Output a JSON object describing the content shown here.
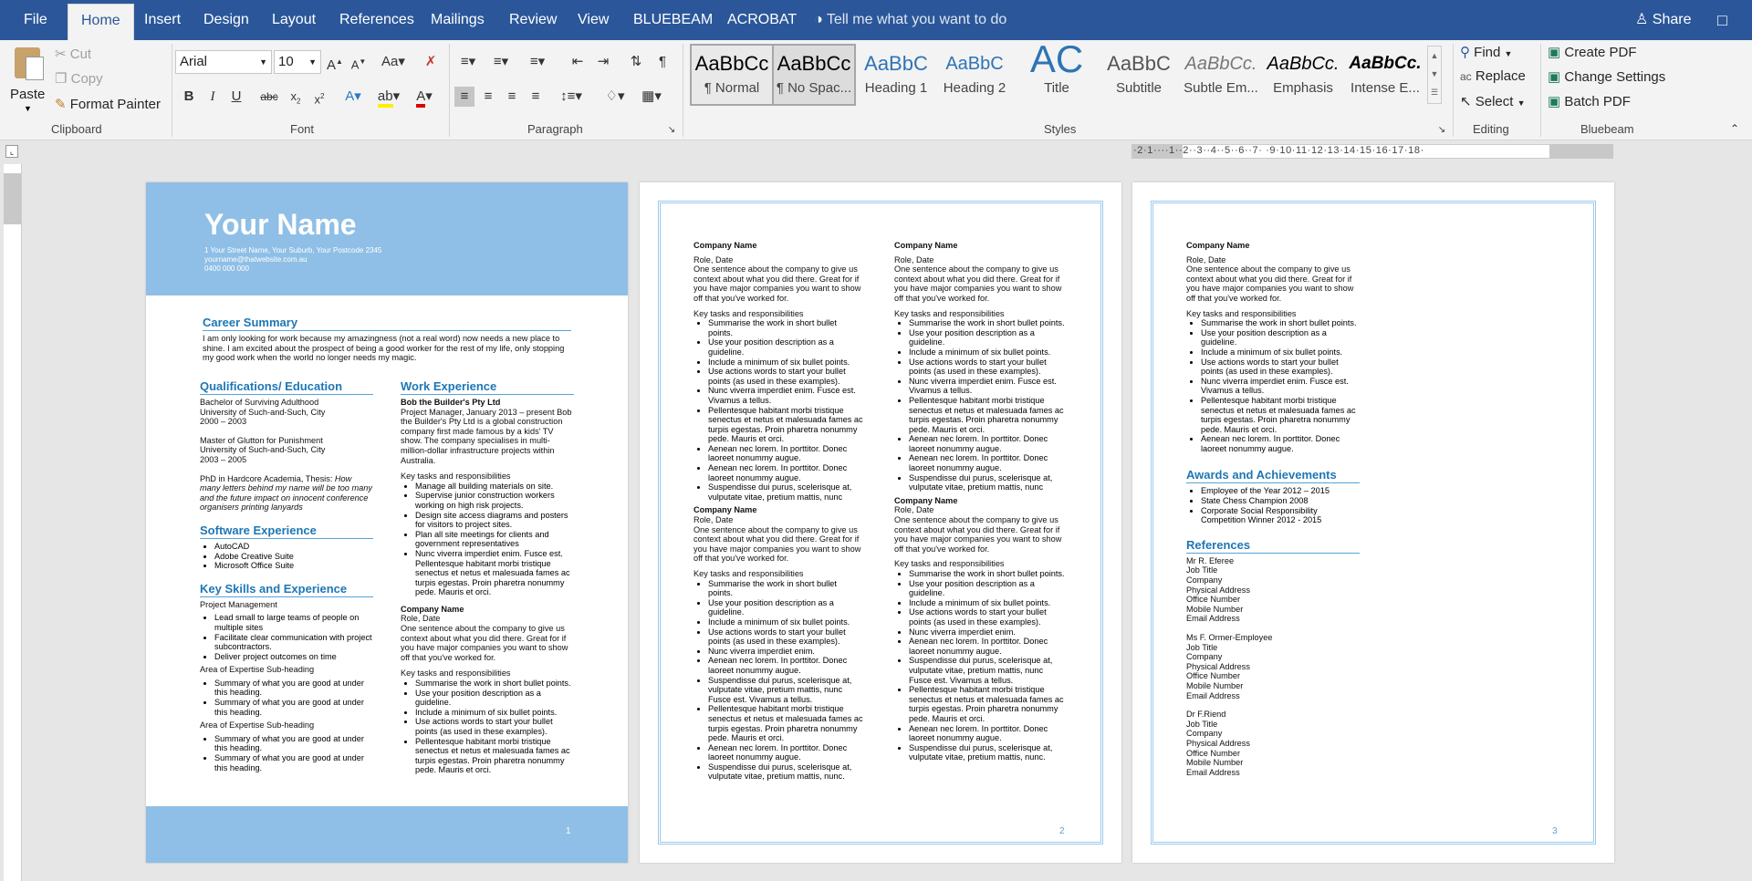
{
  "menubar": {
    "file": "File",
    "tabs": [
      "Home",
      "Insert",
      "Design",
      "Layout",
      "References",
      "Mailings",
      "Review",
      "View",
      "BLUEBEAM",
      "ACROBAT"
    ],
    "tell_me": "Tell me what you want to do",
    "share": "Share"
  },
  "clipboard": {
    "paste": "Paste",
    "cut": "Cut",
    "copy": "Copy",
    "format_painter": "Format Painter",
    "group": "Clipboard"
  },
  "font": {
    "name": "Arial",
    "size": "10",
    "group": "Font"
  },
  "paragraph": {
    "group": "Paragraph"
  },
  "styles": {
    "group": "Styles",
    "items": [
      {
        "preview": "AaBbCc",
        "label": "¶ Normal"
      },
      {
        "preview": "AaBbCc",
        "label": "¶ No Spac..."
      },
      {
        "preview": "AaBbC",
        "label": "Heading 1"
      },
      {
        "preview": "AaBbC",
        "label": "Heading 2"
      },
      {
        "preview": "AC",
        "label": "Title"
      },
      {
        "preview": "AaBbC",
        "label": "Subtitle"
      },
      {
        "preview": "AaBbCc.",
        "label": "Subtle Em..."
      },
      {
        "preview": "AaBbCc.",
        "label": "Emphasis"
      },
      {
        "preview": "AaBbCc.",
        "label": "Intense E..."
      }
    ]
  },
  "editing": {
    "find": "Find",
    "replace": "Replace",
    "select": "Select",
    "group": "Editing"
  },
  "bluebeam": {
    "create_pdf": "Create PDF",
    "change_settings": "Change Settings",
    "batch_pdf": "Batch PDF",
    "group": "Bluebeam"
  },
  "ruler": {
    "text": "·2·1····1··2··3··4··5··6··7·  ·9·10·11·12·13·14·15·16·17·18·"
  },
  "page1": {
    "name": "Your Name",
    "address": "1 Your Street Name, Your Suburb, Your Postcode 2345",
    "email": "yourname@thatwebsite.com.au",
    "phone": "0400 000 000",
    "career_h": "Career Summary",
    "career": "I am only looking for work because my amazingness (not a real word) now needs a new place to shine. I am excited about the prospect of being a good worker for the rest of my life, only stopping my good work when the world no longer needs my magic.",
    "qual_h": "Qualifications/ Education",
    "q1": [
      "Bachelor of Surviving Adulthood",
      "University of Such-and-Such, City",
      "2000 – 2003"
    ],
    "q2": [
      "Master of Glutton for Punishment",
      "University of Such-and-Such, City",
      "2003 – 2005"
    ],
    "q3a": "PhD in Hardcore Academia, Thesis: ",
    "q3b": "How many letters behind my name will be too many and the future impact on innocent conference organisers printing lanyards",
    "soft_h": "Software Experience",
    "soft": [
      "AutoCAD",
      "Adobe Creative Suite",
      "Microsoft Office Suite"
    ],
    "skills_h": "Key Skills and Experience",
    "pm": "Project Management",
    "pm_items": [
      "Lead small to large teams of people on multiple sites",
      "Facilitate clear communication with project subcontractors.",
      "Deliver project outcomes on time"
    ],
    "area": "Area of Expertise Sub-heading",
    "area_items": [
      "Summary of what you are good at under this heading.",
      "Summary of what you are good at under this heading."
    ],
    "work_h": "Work Experience",
    "w1_company": "Bob the Builder's Pty Ltd",
    "w1_text": "Project Manager, January 2013 – present Bob the Builder's Pty Ltd is a global construction company first made famous by a kids' TV show. The company specialises in multi-million-dollar infrastructure projects within Australia.",
    "w1_items": [
      "Manage all building materials on site.",
      "Supervise junior construction workers working on high risk projects.",
      "Design site access diagrams and posters for visitors to project sites.",
      "Plan all site meetings for clients and government representatives",
      "Nunc viverra imperdiet enim. Fusce est. Pellentesque habitant morbi tristique senectus et netus et malesuada fames ac turpis egestas. Proin pharetra nonummy pede. Mauris et orci."
    ],
    "w2_items": [
      "Summarise the work in short bullet points.",
      "Use your position description as a guideline.",
      "Include a minimum of six bullet points.",
      "Use actions words to start your bullet points (as used in these examples).",
      "Pellentesque habitant morbi tristique senectus et netus et malesuada fames ac turpis egestas. Proin pharetra nonummy pede. Mauris et orci."
    ],
    "num": "1"
  },
  "common": {
    "company": "Company Name",
    "role": "Role, Date",
    "sentence": "One sentence about the company to give us context about what you did there. Great for if you have major companies you want to show off that you've worked for.",
    "key": "Key tasks and responsibilities",
    "items_a": [
      "Summarise the work in short bullet points.",
      "Use your position description as a guideline.",
      "Include a minimum of six bullet points.",
      "Use actions words to start your bullet points (as used in these examples).",
      "Nunc viverra imperdiet enim. Fusce est. Vivamus a tellus.",
      "Pellentesque habitant morbi tristique senectus et netus et malesuada fames ac turpis egestas. Proin pharetra nonummy pede. Mauris et orci.",
      "Aenean nec lorem. In porttitor. Donec laoreet nonummy augue.",
      "Aenean nec lorem. In porttitor. Donec laoreet nonummy augue.",
      "Suspendisse dui purus, scelerisque at, vulputate vitae, pretium mattis, nunc"
    ],
    "items_b": [
      "Summarise the work in short bullet points.",
      "Use your position description as a guideline.",
      "Include a minimum of six bullet points.",
      "Use actions words to start your bullet points (as used in these examples).",
      "Nunc viverra imperdiet enim.",
      "Aenean nec lorem. In porttitor. Donec laoreet nonummy augue.",
      "Suspendisse dui purus, scelerisque at, vulputate vitae, pretium mattis, nunc Fusce est. Vivamus a tellus.",
      "Pellentesque habitant morbi tristique senectus et netus et malesuada fames ac turpis egestas. Proin pharetra nonummy pede. Mauris et orci.",
      "Aenean nec lorem. In porttitor. Donec laoreet nonummy augue.",
      "Suspendisse dui purus, scelerisque at, vulputate vitae, pretium mattis, nunc."
    ],
    "items_c": [
      "Summarise the work in short bullet points.",
      "Use your position description as a guideline.",
      "Include a minimum of six bullet points.",
      "Use actions words to start your bullet points (as used in these examples).",
      "Nunc viverra imperdiet enim. Fusce est. Vivamus a tellus.",
      "Pellentesque habitant morbi tristique senectus et netus et malesuada fames ac turpis egestas. Proin pharetra nonummy pede. Mauris et orci.",
      "Aenean nec lorem. In porttitor. Donec laoreet nonummy augue."
    ]
  },
  "page2": {
    "num": "2"
  },
  "page3": {
    "awards_h": "Awards and Achievements",
    "awards": [
      "Employee of the Year 2012 – 2015",
      "State Chess Champion 2008",
      "Corporate Social Responsibility Competition Winner 2012 - 2015"
    ],
    "refs_h": "References",
    "ref1": [
      "Mr R. Eferee",
      "Job Title",
      "Company",
      "Physical Address",
      "Office Number",
      "Mobile Number",
      "Email Address"
    ],
    "ref2": [
      "Ms F. Ormer-Employee",
      "Job Title",
      "Company",
      "Physical Address",
      "Office Number",
      "Mobile Number",
      "Email Address"
    ],
    "ref3": [
      "Dr F.Riend",
      "Job Title",
      "Company",
      "Physical Address",
      "Office Number",
      "Mobile Number",
      "Email Address"
    ],
    "num": "3"
  }
}
